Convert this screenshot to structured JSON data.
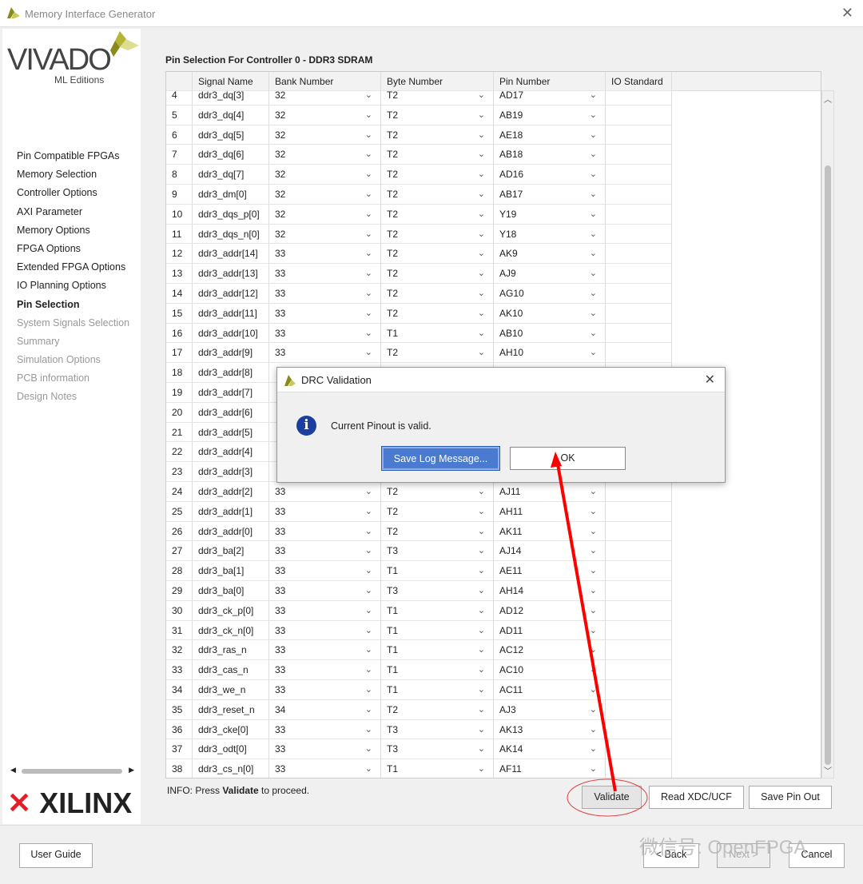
{
  "window": {
    "title": "Memory Interface Generator",
    "close_icon": "close-icon"
  },
  "logo": {
    "product": "VIVADO",
    "edition": "ML Editions",
    "vendor": "XILINX"
  },
  "sidebar": {
    "items": [
      {
        "label": "Pin Compatible FPGAs",
        "state": "normal"
      },
      {
        "label": "Memory Selection",
        "state": "normal"
      },
      {
        "label": "Controller Options",
        "state": "normal"
      },
      {
        "label": "AXI Parameter",
        "state": "normal"
      },
      {
        "label": "Memory Options",
        "state": "normal"
      },
      {
        "label": "FPGA Options",
        "state": "normal"
      },
      {
        "label": "Extended FPGA Options",
        "state": "normal"
      },
      {
        "label": "IO Planning Options",
        "state": "normal"
      },
      {
        "label": "Pin Selection",
        "state": "active"
      },
      {
        "label": "System Signals Selection",
        "state": "disabled"
      },
      {
        "label": "Summary",
        "state": "disabled"
      },
      {
        "label": "Simulation Options",
        "state": "disabled"
      },
      {
        "label": "PCB information",
        "state": "disabled"
      },
      {
        "label": "Design Notes",
        "state": "disabled"
      }
    ]
  },
  "main": {
    "section_title": "Pin Selection For Controller 0 - DDR3 SDRAM",
    "columns": [
      "",
      "Signal Name",
      "Bank Number",
      "Byte Number",
      "Pin Number",
      "IO Standard"
    ],
    "rows": [
      [
        "4",
        "ddr3_dq[3]",
        "32",
        "T2",
        "AD17"
      ],
      [
        "5",
        "ddr3_dq[4]",
        "32",
        "T2",
        "AB19"
      ],
      [
        "6",
        "ddr3_dq[5]",
        "32",
        "T2",
        "AE18"
      ],
      [
        "7",
        "ddr3_dq[6]",
        "32",
        "T2",
        "AB18"
      ],
      [
        "8",
        "ddr3_dq[7]",
        "32",
        "T2",
        "AD16"
      ],
      [
        "9",
        "ddr3_dm[0]",
        "32",
        "T2",
        "AB17"
      ],
      [
        "10",
        "ddr3_dqs_p[0]",
        "32",
        "T2",
        "Y19"
      ],
      [
        "11",
        "ddr3_dqs_n[0]",
        "32",
        "T2",
        "Y18"
      ],
      [
        "12",
        "ddr3_addr[14]",
        "33",
        "T2",
        "AK9"
      ],
      [
        "13",
        "ddr3_addr[13]",
        "33",
        "T2",
        "AJ9"
      ],
      [
        "14",
        "ddr3_addr[12]",
        "33",
        "T2",
        "AG10"
      ],
      [
        "15",
        "ddr3_addr[11]",
        "33",
        "T2",
        "AK10"
      ],
      [
        "16",
        "ddr3_addr[10]",
        "33",
        "T1",
        "AB10"
      ],
      [
        "17",
        "ddr3_addr[9]",
        "33",
        "T2",
        "AH10"
      ],
      [
        "18",
        "ddr3_addr[8]",
        "",
        "",
        ""
      ],
      [
        "19",
        "ddr3_addr[7]",
        "",
        "",
        ""
      ],
      [
        "20",
        "ddr3_addr[6]",
        "",
        "",
        ""
      ],
      [
        "21",
        "ddr3_addr[5]",
        "",
        "",
        ""
      ],
      [
        "22",
        "ddr3_addr[4]",
        "",
        "",
        ""
      ],
      [
        "23",
        "ddr3_addr[3]",
        "",
        "",
        ""
      ],
      [
        "24",
        "ddr3_addr[2]",
        "33",
        "T2",
        "AJ11"
      ],
      [
        "25",
        "ddr3_addr[1]",
        "33",
        "T2",
        "AH11"
      ],
      [
        "26",
        "ddr3_addr[0]",
        "33",
        "T2",
        "AK11"
      ],
      [
        "27",
        "ddr3_ba[2]",
        "33",
        "T3",
        "AJ14"
      ],
      [
        "28",
        "ddr3_ba[1]",
        "33",
        "T1",
        "AE11"
      ],
      [
        "29",
        "ddr3_ba[0]",
        "33",
        "T3",
        "AH14"
      ],
      [
        "30",
        "ddr3_ck_p[0]",
        "33",
        "T1",
        "AD12"
      ],
      [
        "31",
        "ddr3_ck_n[0]",
        "33",
        "T1",
        "AD11"
      ],
      [
        "32",
        "ddr3_ras_n",
        "33",
        "T1",
        "AC12"
      ],
      [
        "33",
        "ddr3_cas_n",
        "33",
        "T1",
        "AC10"
      ],
      [
        "34",
        "ddr3_we_n",
        "33",
        "T1",
        "AC11"
      ],
      [
        "35",
        "ddr3_reset_n",
        "34",
        "T2",
        "AJ3"
      ],
      [
        "36",
        "ddr3_cke[0]",
        "33",
        "T3",
        "AK13"
      ],
      [
        "37",
        "ddr3_odt[0]",
        "33",
        "T3",
        "AK14"
      ],
      [
        "38",
        "ddr3_cs_n[0]",
        "33",
        "T1",
        "AF11"
      ]
    ],
    "info_prefix": "INFO: Press ",
    "info_bold": "Validate",
    "info_suffix": " to proceed.",
    "buttons": {
      "validate": "Validate",
      "read_xdc": "Read XDC/UCF",
      "save_pin_out": "Save Pin Out"
    }
  },
  "dialog": {
    "title": "DRC Validation",
    "message": "Current Pinout is valid.",
    "save_log": "Save Log Message...",
    "ok": "OK"
  },
  "footer": {
    "user_guide": "User Guide",
    "back": "< Back",
    "next": "Next >",
    "cancel": "Cancel"
  },
  "watermark": "微信号: OpenFPGA",
  "colors": {
    "accent": "#4a7bd0",
    "annotation": "#ff0000",
    "info_icon": "#1a3fa0"
  }
}
